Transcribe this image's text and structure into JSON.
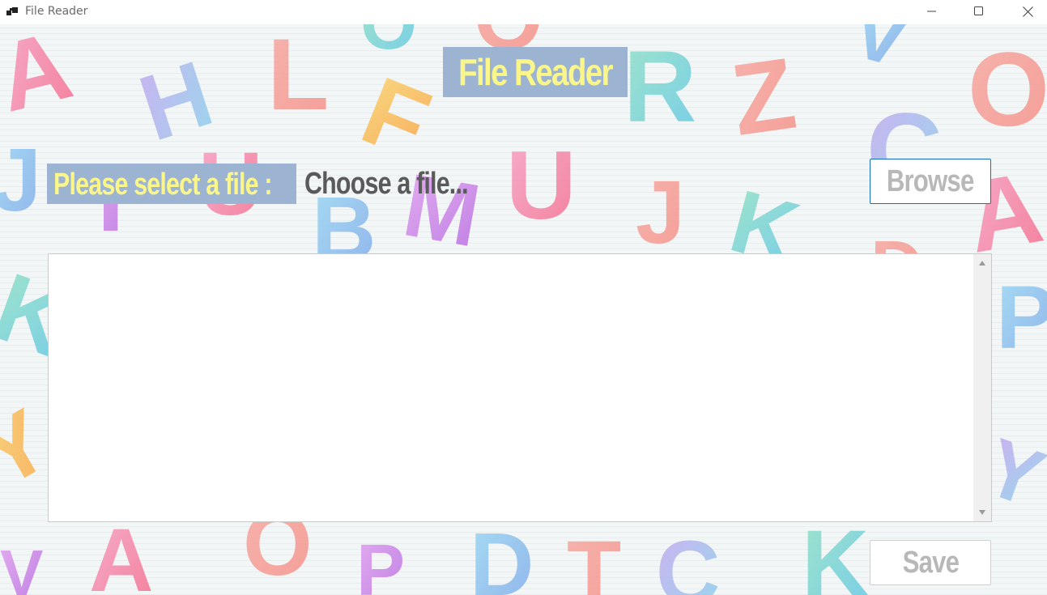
{
  "window": {
    "title": "File Reader",
    "icon": "app-window-icon",
    "controls": {
      "minimize_icon": "minimize-icon",
      "maximize_icon": "maximize-icon",
      "close_icon": "close-icon"
    }
  },
  "main": {
    "heading": "File Reader",
    "select_label": "Please select a file :",
    "file_input": {
      "value": "",
      "placeholder": "Choose a file..."
    },
    "browse_button": "Browse",
    "content_text": "",
    "save_button": "Save"
  },
  "colors": {
    "label_background": "#9cb4d2",
    "label_text": "#fbf68a",
    "button_text_disabled": "#b8b8b8",
    "browse_border_focus": "#1a6fb0",
    "input_background": "#f0f0f0",
    "placeholder_text": "#5a5a5a"
  },
  "background": {
    "description_icon": "watercolor-alphabet-background"
  }
}
